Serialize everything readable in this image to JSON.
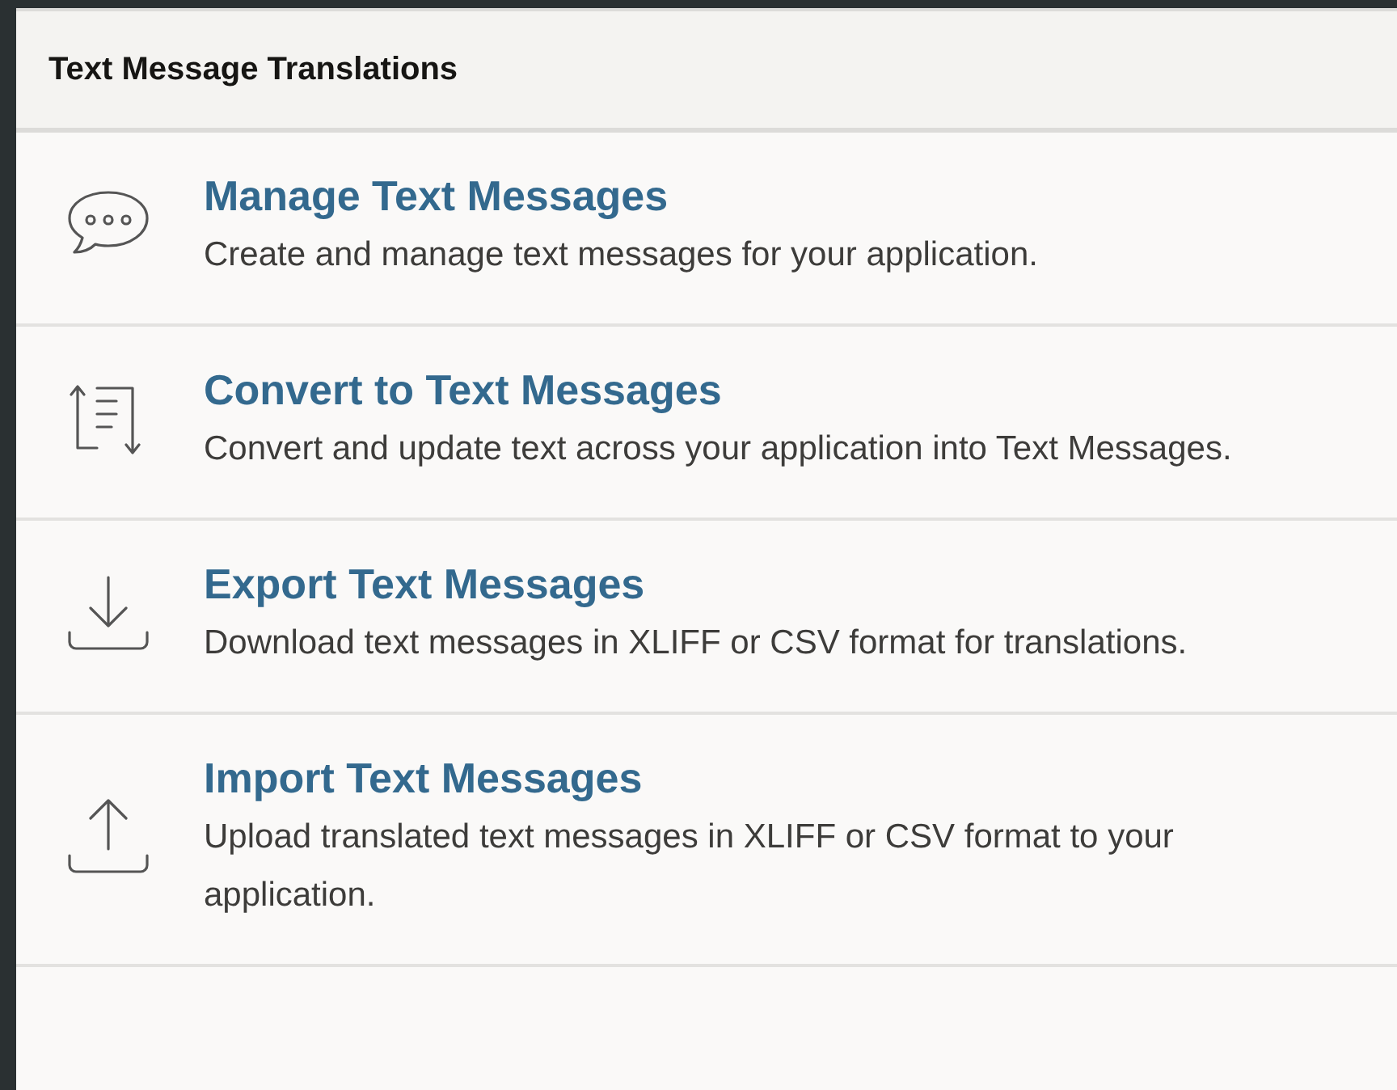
{
  "header": {
    "title": "Text Message Translations"
  },
  "items": [
    {
      "kind": "chat",
      "title": "Manage Text Messages",
      "description": "Create and manage text messages for your application."
    },
    {
      "kind": "convert",
      "title": "Convert to Text Messages",
      "description": "Convert and update text across your application into Text Messages."
    },
    {
      "kind": "download",
      "title": "Export Text Messages",
      "description": "Download text messages in XLIFF or CSV format for translations."
    },
    {
      "kind": "upload",
      "title": "Import Text Messages",
      "description": "Upload translated text messages in XLIFF or CSV format to your application."
    }
  ]
}
